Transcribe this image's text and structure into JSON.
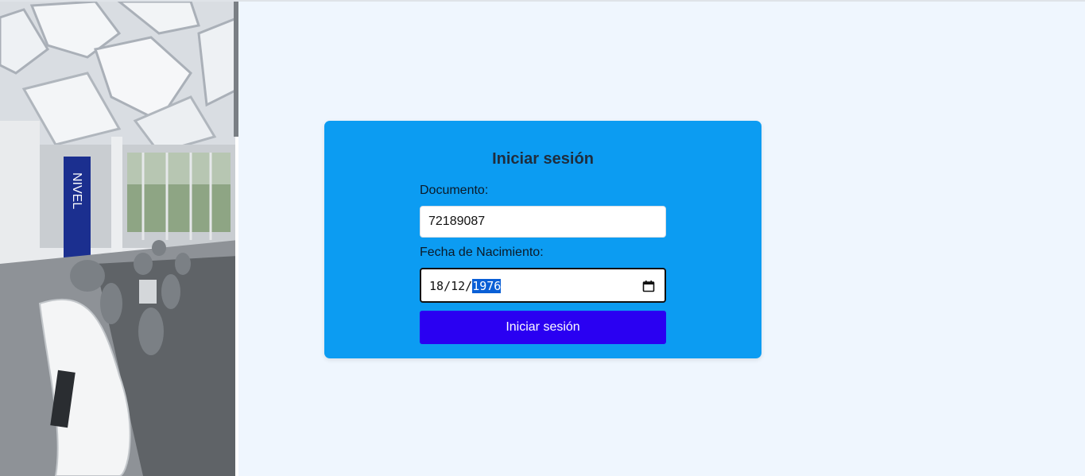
{
  "login": {
    "title": "Iniciar sesión",
    "document_label": "Documento:",
    "document_value": "72189087",
    "birthdate_label": "Fecha de Nacimiento:",
    "birthdate": {
      "day": "18",
      "month": "12",
      "year": "1976",
      "separator": "/"
    },
    "submit_label": "Iniciar sesión"
  },
  "lobby_image": {
    "signage_text": "NIVEL"
  },
  "colors": {
    "page_bg": "#eff6fe",
    "card_bg": "#0c9cf2",
    "button_bg": "#2a00f2",
    "selection": "#0a5fd6"
  },
  "icons": {
    "date_picker": "calendar-icon"
  }
}
